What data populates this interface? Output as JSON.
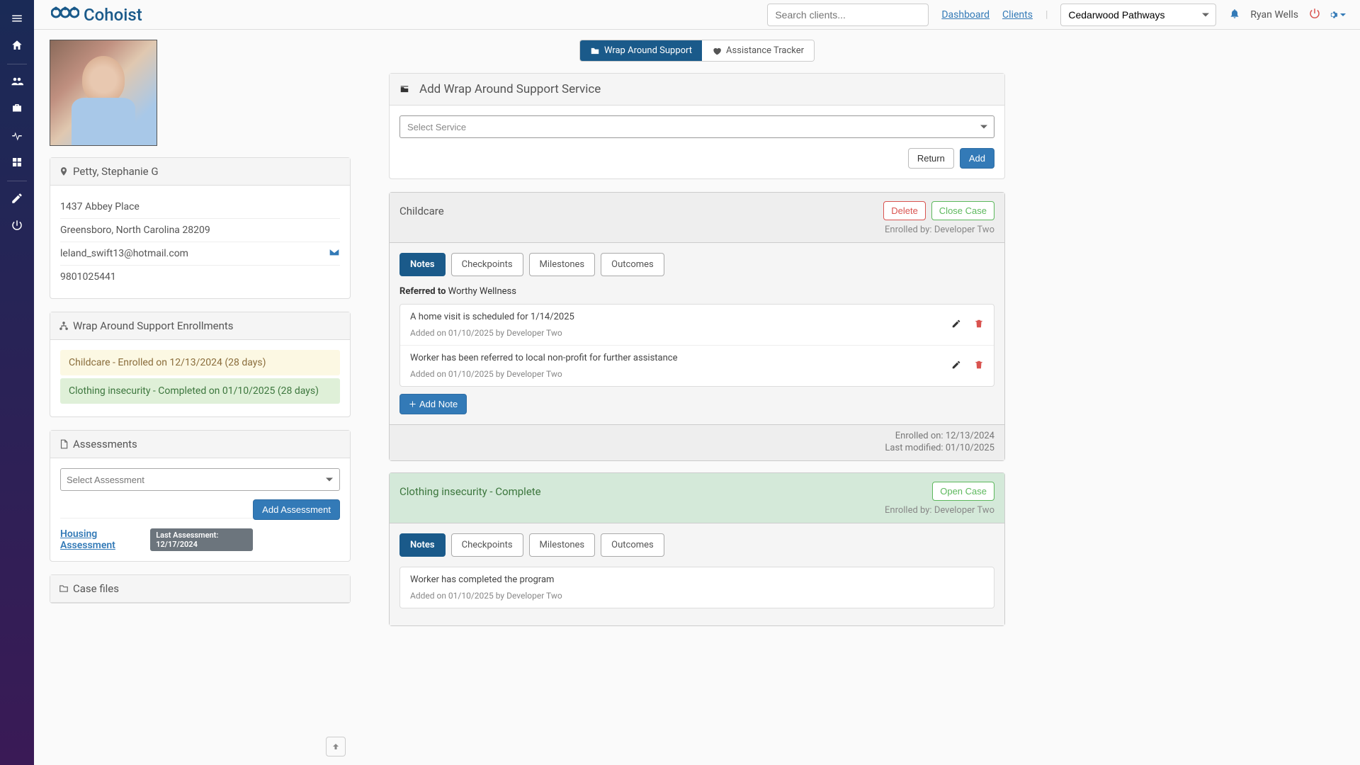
{
  "header": {
    "brand": "Cohoist",
    "search_placeholder": "Search clients...",
    "links": {
      "dashboard": "Dashboard",
      "clients": "Clients"
    },
    "org_selected": "Cedarwood Pathways",
    "user_name": "Ryan Wells"
  },
  "tabs": {
    "wrap": "Wrap Around Support",
    "assistance": "Assistance Tracker"
  },
  "client": {
    "name": "Petty, Stephanie G",
    "address1": "1437 Abbey Place",
    "address2": "Greensboro, North Carolina 28209",
    "email": "leland_swift13@hotmail.com",
    "phone": "9801025441"
  },
  "enrollments": {
    "title": "Wrap Around Support Enrollments",
    "items": [
      {
        "text": "Childcare - Enrolled on 12/13/2024 (28 days)",
        "status": "warning"
      },
      {
        "text": "Clothing insecurity - Completed on 01/10/2025 (28 days)",
        "status": "success"
      }
    ]
  },
  "assessments": {
    "title": "Assessments",
    "select_placeholder": "Select Assessment",
    "add_btn": "Add Assessment",
    "link_label": "Housing Assessment",
    "pill": "Last Assessment: 12/17/2024"
  },
  "case_files": {
    "title": "Case files"
  },
  "add_service": {
    "title": "Add Wrap Around Support Service",
    "select_placeholder": "Select Service",
    "return": "Return",
    "add": "Add"
  },
  "sub_tabs": {
    "notes": "Notes",
    "checkpoints": "Checkpoints",
    "milestones": "Milestones",
    "outcomes": "Outcomes"
  },
  "case1": {
    "title": "Childcare",
    "delete": "Delete",
    "close": "Close Case",
    "enrolled_by_label": "Enrolled by:",
    "enrolled_by": "Developer Two",
    "referred_label": "Referred to",
    "referred_to": "Worthy Wellness",
    "notes": [
      {
        "text": "A home visit is scheduled for 1/14/2025",
        "meta": "Added on 01/10/2025 by Developer Two"
      },
      {
        "text": "Worker has been referred to local non-profit for further assistance",
        "meta": "Added on 01/10/2025 by Developer Two"
      }
    ],
    "add_note": "Add Note",
    "footer": {
      "enrolled_label": "Enrolled on:",
      "enrolled_date": "12/13/2024",
      "modified_label": "Last modified:",
      "modified_date": "01/10/2025"
    }
  },
  "case2": {
    "title": "Clothing insecurity - Complete",
    "open": "Open Case",
    "enrolled_by_label": "Enrolled by:",
    "enrolled_by": "Developer Two",
    "notes": [
      {
        "text": "Worker has completed the program",
        "meta": "Added on 01/10/2025 by Developer Two"
      }
    ]
  }
}
